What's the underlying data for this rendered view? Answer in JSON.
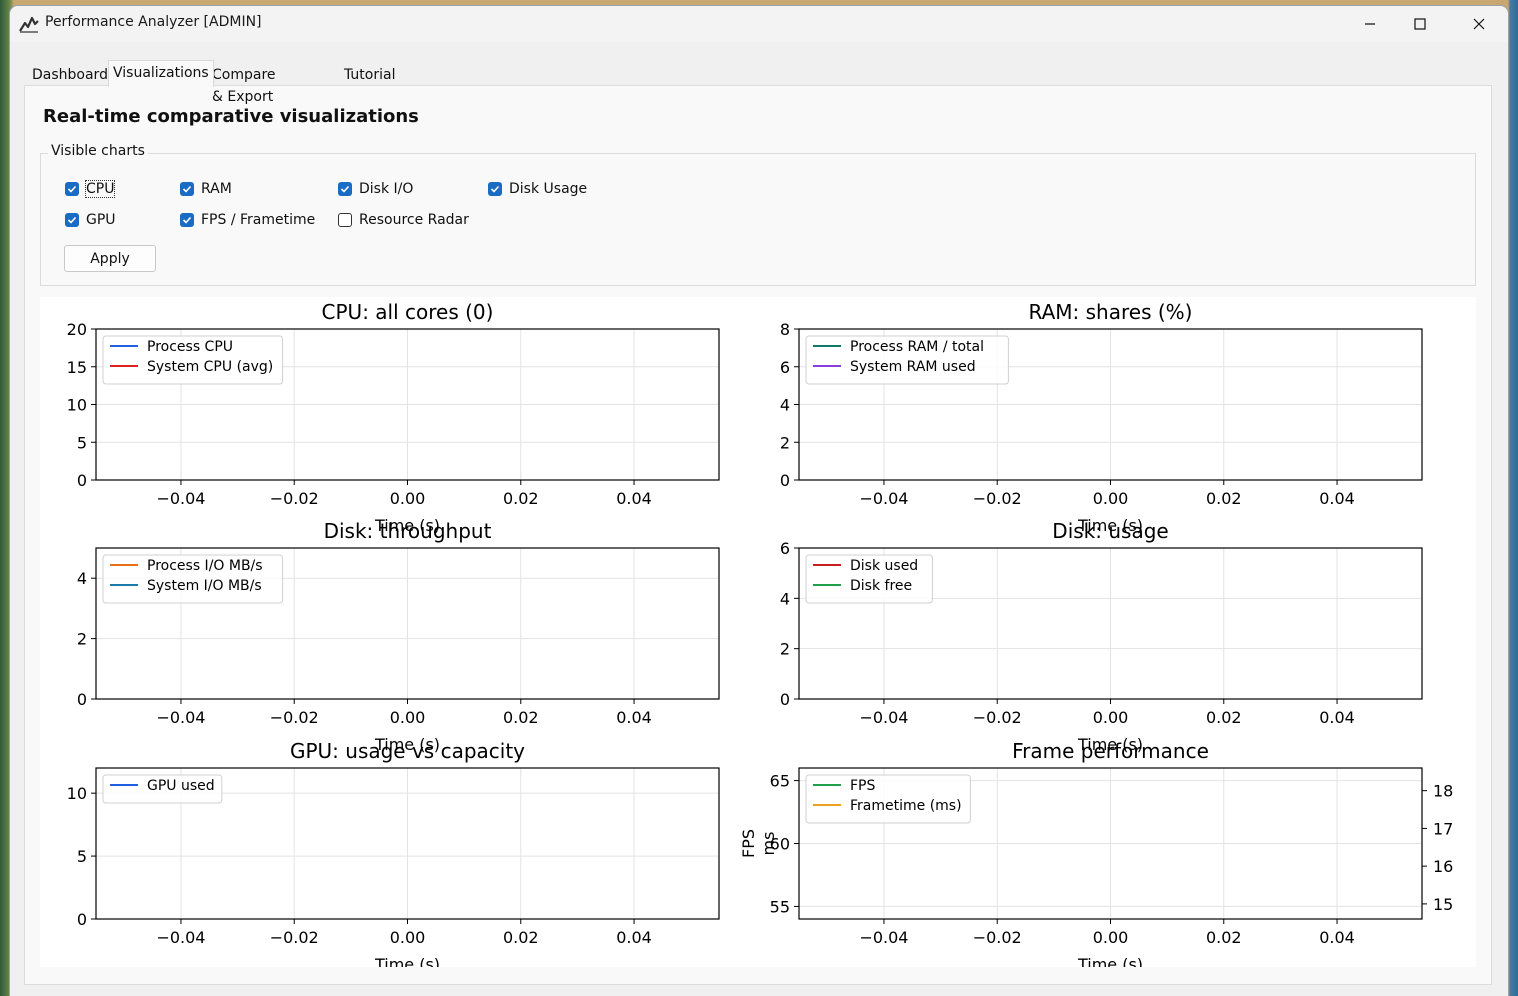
{
  "window": {
    "title": "Performance Analyzer [ADMIN]",
    "controls": {
      "minimize": "minimize-icon",
      "maximize": "maximize-icon",
      "close": "close-icon"
    }
  },
  "tabs": [
    {
      "label": "Dashboard",
      "active": false
    },
    {
      "label": "Visualizations",
      "active": true
    },
    {
      "label": "Compare & Export",
      "active": false
    },
    {
      "label": "Tutorial",
      "active": false
    }
  ],
  "section_title": "Real-time comparative visualizations",
  "visible_charts": {
    "label": "Visible charts",
    "options": [
      {
        "label": "CPU",
        "checked": true
      },
      {
        "label": "RAM",
        "checked": true
      },
      {
        "label": "Disk I/O",
        "checked": true
      },
      {
        "label": "Disk Usage",
        "checked": true
      },
      {
        "label": "GPU",
        "checked": true
      },
      {
        "label": "FPS / Frametime",
        "checked": true
      },
      {
        "label": "Resource Radar",
        "checked": false
      }
    ],
    "apply_label": "Apply"
  },
  "colors": {
    "accent": "#1a6bc4",
    "process_cpu": "#1f5fe0",
    "system_cpu": "#e02020",
    "process_ram": "#0e7a68",
    "system_ram": "#8a3ee0",
    "process_io": "#e8701a",
    "system_io": "#1a7aa8",
    "disk_used": "#c81e1e",
    "disk_free": "#20a048",
    "gpu_used": "#1f5fe0",
    "fps": "#20a048",
    "frametime": "#f0a020"
  },
  "chart_data": [
    {
      "type": "line",
      "title": "CPU: all cores (0)",
      "xlabel": "Time (s)",
      "ylabel": "",
      "xlim": [
        -0.055,
        0.055
      ],
      "ylim": [
        0,
        20
      ],
      "xticks": [
        "−0.04",
        "−0.02",
        "0.00",
        "0.02",
        "0.04"
      ],
      "yticks": [
        "0",
        "5",
        "10",
        "15",
        "20"
      ],
      "grid": true,
      "legend": "top-left",
      "series": [
        {
          "name": "Process CPU",
          "color": "#1f5fe0",
          "x": [],
          "y": []
        },
        {
          "name": "System CPU (avg)",
          "color": "#e02020",
          "x": [],
          "y": []
        }
      ]
    },
    {
      "type": "line",
      "title": "RAM: shares (%)",
      "xlabel": "Time (s)",
      "ylabel": "",
      "xlim": [
        -0.055,
        0.055
      ],
      "ylim": [
        0,
        8
      ],
      "xticks": [
        "−0.04",
        "−0.02",
        "0.00",
        "0.02",
        "0.04"
      ],
      "yticks": [
        "0",
        "2",
        "4",
        "6",
        "8"
      ],
      "grid": true,
      "legend": "top-left",
      "series": [
        {
          "name": "Process RAM / total",
          "color": "#0e7a68",
          "x": [],
          "y": []
        },
        {
          "name": "System RAM used",
          "color": "#8a3ee0",
          "x": [],
          "y": []
        }
      ]
    },
    {
      "type": "line",
      "title": "Disk: throughput",
      "xlabel": "Time (s)",
      "ylabel": "",
      "xlim": [
        -0.055,
        0.055
      ],
      "ylim": [
        0,
        5
      ],
      "xticks": [
        "−0.04",
        "−0.02",
        "0.00",
        "0.02",
        "0.04"
      ],
      "yticks": [
        "0",
        "2",
        "4"
      ],
      "grid": true,
      "legend": "top-left",
      "series": [
        {
          "name": "Process I/O MB/s",
          "color": "#e8701a",
          "x": [],
          "y": []
        },
        {
          "name": "System I/O MB/s",
          "color": "#1a7aa8",
          "x": [],
          "y": []
        }
      ]
    },
    {
      "type": "line",
      "title": "Disk: usage",
      "xlabel": "Time (s)",
      "ylabel": "",
      "xlim": [
        -0.055,
        0.055
      ],
      "ylim": [
        0,
        6
      ],
      "xticks": [
        "−0.04",
        "−0.02",
        "0.00",
        "0.02",
        "0.04"
      ],
      "yticks": [
        "0",
        "2",
        "4",
        "6"
      ],
      "grid": true,
      "legend": "top-left",
      "series": [
        {
          "name": "Disk used",
          "color": "#c81e1e",
          "x": [],
          "y": []
        },
        {
          "name": "Disk free",
          "color": "#20a048",
          "x": [],
          "y": []
        }
      ]
    },
    {
      "type": "line",
      "title": "GPU: usage vs capacity",
      "xlabel": "Time (s)",
      "ylabel": "",
      "xlim": [
        -0.055,
        0.055
      ],
      "ylim": [
        0,
        12
      ],
      "xticks": [
        "−0.04",
        "−0.02",
        "0.00",
        "0.02",
        "0.04"
      ],
      "yticks": [
        "0",
        "5",
        "10"
      ],
      "grid": true,
      "legend": "top-left",
      "series": [
        {
          "name": "GPU used",
          "color": "#1f5fe0",
          "x": [],
          "y": []
        }
      ]
    },
    {
      "type": "line",
      "title": "Frame performance",
      "xlabel": "Time (s)",
      "ylabel": "FPS",
      "ylabel_right": "ms",
      "xlim": [
        -0.055,
        0.055
      ],
      "ylim": [
        54,
        66
      ],
      "ylim_right": [
        14.6,
        18.6
      ],
      "xticks": [
        "−0.04",
        "−0.02",
        "0.00",
        "0.02",
        "0.04"
      ],
      "yticks": [
        "55",
        "60",
        "65"
      ],
      "yticks_right": [
        "15",
        "16",
        "17",
        "18"
      ],
      "grid": true,
      "legend": "top-left",
      "series": [
        {
          "name": "FPS",
          "color": "#20a048",
          "x": [],
          "y": []
        },
        {
          "name": "Frametime (ms)",
          "color": "#f0a020",
          "x": [],
          "y": []
        }
      ]
    }
  ]
}
